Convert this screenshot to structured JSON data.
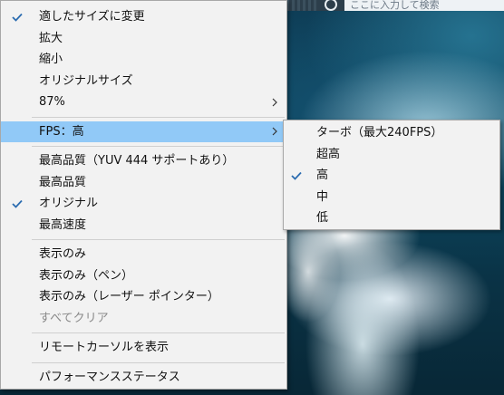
{
  "taskbar": {
    "search_placeholder": "ここに入力して検索"
  },
  "main_menu": {
    "items": [
      {
        "label": "適したサイズに変更",
        "checked": true
      },
      {
        "label": "拡大"
      },
      {
        "label": "縮小"
      },
      {
        "label": "オリジナルサイズ"
      },
      {
        "label": "87%",
        "has_submenu": true
      },
      {
        "label": "FPS：高",
        "has_submenu": true,
        "highlighted": true
      },
      {
        "label": "最高品質（YUV 444 サポートあり）"
      },
      {
        "label": "最高品質"
      },
      {
        "label": "オリジナル",
        "checked": true
      },
      {
        "label": "最高速度"
      },
      {
        "label": "表示のみ"
      },
      {
        "label": "表示のみ（ペン）"
      },
      {
        "label": "表示のみ（レーザー ポインター）"
      },
      {
        "label": "すべてクリア",
        "disabled": true
      },
      {
        "label": "リモートカーソルを表示"
      },
      {
        "label": "パフォーマンスステータス"
      }
    ]
  },
  "fps_submenu": {
    "items": [
      {
        "label": "ターボ（最大240FPS）"
      },
      {
        "label": "超高"
      },
      {
        "label": "高",
        "checked": true
      },
      {
        "label": "中"
      },
      {
        "label": "低"
      }
    ]
  },
  "colors": {
    "menu_bg": "#f2f2f2",
    "highlight": "#91c9f7",
    "check_color": "#2b6cb0",
    "disabled_text": "#8a8a8a"
  },
  "icons": {
    "check": "check-icon",
    "submenu_arrow": "chevron-right-icon"
  }
}
